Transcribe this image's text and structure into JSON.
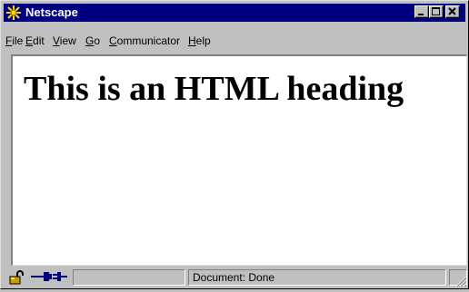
{
  "window": {
    "title": "Netscape"
  },
  "menu": [
    {
      "accel": "F",
      "rest": "ile"
    },
    {
      "accel": "E",
      "rest": "dit"
    },
    {
      "accel": "V",
      "rest": "iew"
    },
    {
      "accel": "G",
      "rest": "o"
    },
    {
      "accel": "C",
      "rest": "ommunicator"
    },
    {
      "accel": "H",
      "rest": "elp"
    }
  ],
  "page": {
    "heading": "This is an HTML heading"
  },
  "status": {
    "text": "Document: Done"
  },
  "icons": {
    "app": "netscape-logo-icon",
    "minimize": "minimize-icon",
    "maximize": "maximize-icon",
    "close": "close-icon",
    "security": "padlock-icon",
    "connection": "plug-icon",
    "resize": "size-grip-icon"
  },
  "colors": {
    "titlebar": "#000080",
    "chrome": "#c0c0c0",
    "content": "#ffffff"
  }
}
